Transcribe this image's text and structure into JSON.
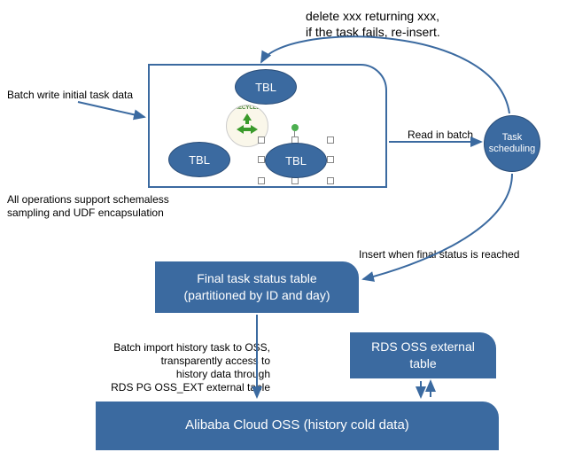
{
  "annotations": {
    "top_note_l1": "delete xxx returning xxx,",
    "top_note_l2": "if the task fails, re-insert.",
    "batch_write": "Batch write initial task data",
    "all_ops_l1": "All operations support schemaless",
    "all_ops_l2": "sampling and UDF encapsulation",
    "read_batch": "Read in batch",
    "insert_final": "Insert when final status is reached",
    "batch_import_l1": "Batch import history task to OSS,",
    "batch_import_l2": "transparently access to",
    "batch_import_l3": "history data through",
    "batch_import_l4": "RDS PG OSS_EXT external table"
  },
  "nodes": {
    "tbl1": "TBL",
    "tbl2": "TBL",
    "tbl3": "TBL",
    "recycle_label": "RECYCLE",
    "task_scheduling_l1": "Task",
    "task_scheduling_l2": "scheduling",
    "final_status_l1": "Final task status table",
    "final_status_l2": "(partitioned by ID and day)",
    "rds_oss_l1": "RDS OSS external",
    "rds_oss_l2": "table",
    "alibaba_oss": "Alibaba Cloud OSS (history cold data)"
  },
  "colors": {
    "primary": "#3b6aa0",
    "recycle_green": "#3a9a2b"
  },
  "chart_data": {
    "type": "diagram",
    "nodes": [
      {
        "id": "container",
        "label": "TBL staging container (3× TBL, recycle)"
      },
      {
        "id": "task_scheduling",
        "label": "Task scheduling"
      },
      {
        "id": "final_status",
        "label": "Final task status table (partitioned by ID and day)"
      },
      {
        "id": "rds_oss",
        "label": "RDS OSS external table"
      },
      {
        "id": "alibaba_oss",
        "label": "Alibaba Cloud OSS (history cold data)"
      }
    ],
    "edges": [
      {
        "from": "external",
        "to": "container",
        "label": "Batch write initial task data"
      },
      {
        "from": "container",
        "to": "task_scheduling",
        "label": "Read in batch"
      },
      {
        "from": "task_scheduling",
        "to": "container",
        "label": "delete xxx returning xxx, if the task fails, re-insert."
      },
      {
        "from": "task_scheduling",
        "to": "final_status",
        "label": "Insert when final status is reached"
      },
      {
        "from": "final_status",
        "to": "alibaba_oss",
        "label": "Batch import history task to OSS, transparently access to history data through RDS PG OSS_EXT external table"
      },
      {
        "from": "rds_oss",
        "to": "alibaba_oss",
        "label": "",
        "bidirectional": true
      }
    ]
  }
}
